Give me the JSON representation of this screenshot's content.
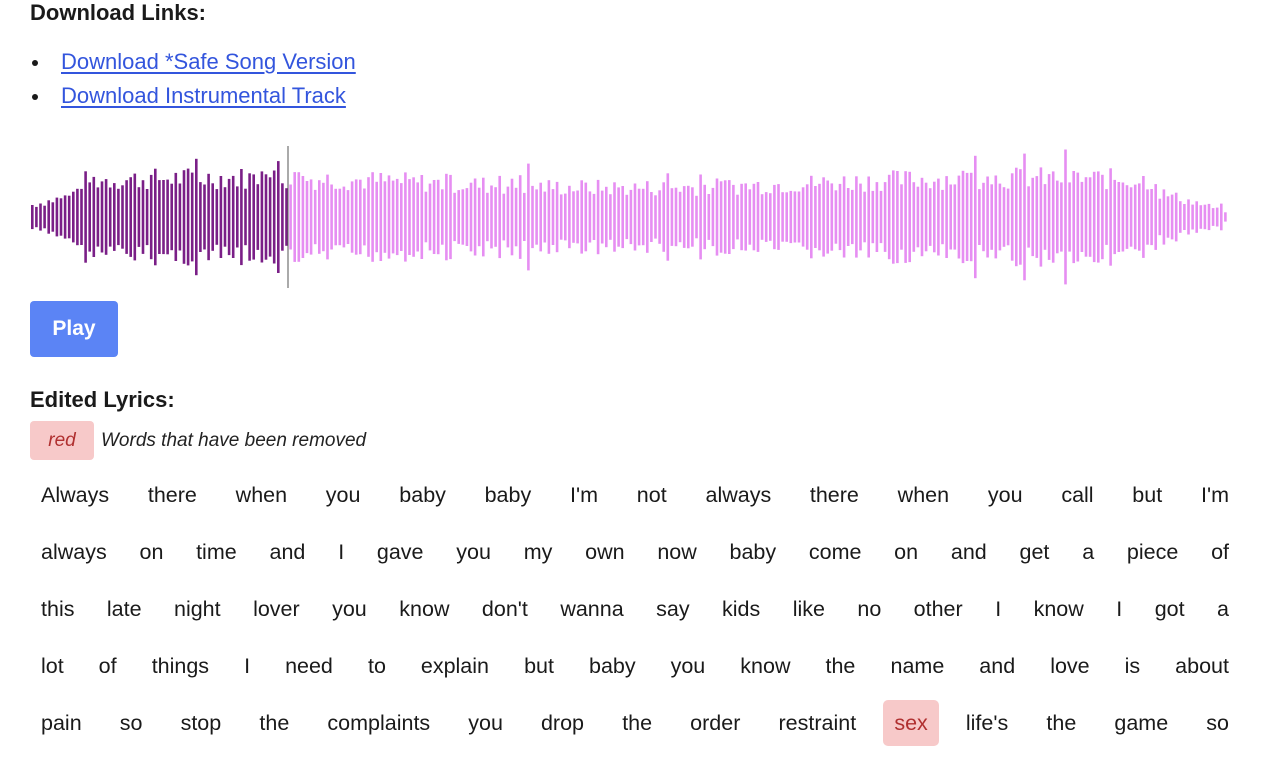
{
  "download": {
    "title": "Download Links:",
    "links": [
      {
        "label": "Download *Safe Song Version"
      },
      {
        "label": "Download Instrumental Track"
      }
    ]
  },
  "player": {
    "play_label": "Play",
    "progress": 0.215,
    "played_color": "#7a1f87",
    "unplayed_color": "#e68ef2",
    "cursor_color": "#555555"
  },
  "lyrics": {
    "title": "Edited Lyrics:",
    "legend": {
      "swatch_label": "red",
      "description": "Words that have been removed"
    },
    "removed_color": "#f7c9c9",
    "lines": [
      [
        "Always",
        "there",
        "when",
        "you",
        "baby",
        "baby",
        "I'm",
        "not",
        "always",
        "there",
        "when",
        "you",
        "call",
        "but",
        "I'm"
      ],
      [
        "always",
        "on",
        "time",
        "and",
        "I",
        "gave",
        "you",
        "my",
        "own",
        "now",
        "baby",
        "come",
        "on",
        "and",
        "get",
        "a",
        "piece",
        "of"
      ],
      [
        "this",
        "late",
        "night",
        "lover",
        "you",
        "know",
        "don't",
        "wanna",
        "say",
        "kids",
        "like",
        "no",
        "other",
        "I",
        "know",
        "I",
        "got",
        "a"
      ],
      [
        "lot",
        "of",
        "things",
        "I",
        "need",
        "to",
        "explain",
        "but",
        "baby",
        "you",
        "know",
        "the",
        "name",
        "and",
        "love",
        "is",
        "about"
      ],
      [
        "pain",
        "so",
        "stop",
        "the",
        "complaints",
        "you",
        "drop",
        "the",
        "order",
        "restraint",
        "sex",
        "life's",
        "the",
        "game",
        "so"
      ]
    ],
    "removed": [
      [
        4,
        10
      ]
    ]
  }
}
